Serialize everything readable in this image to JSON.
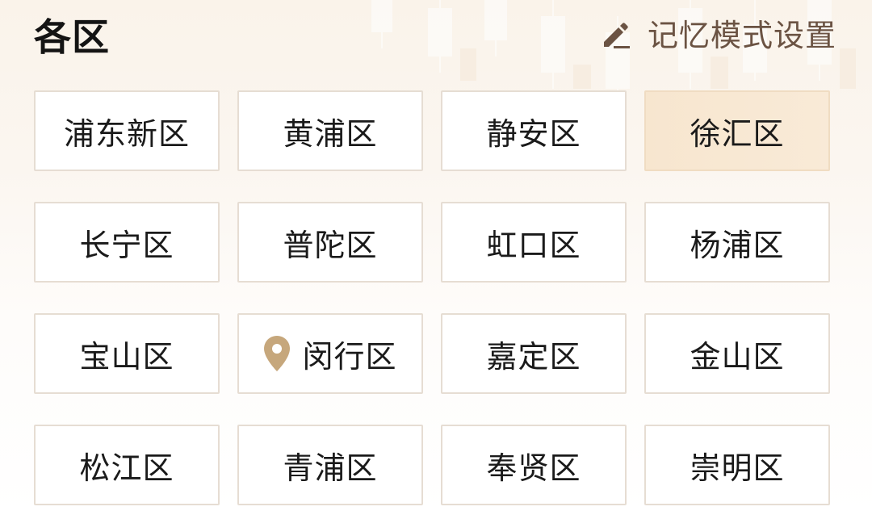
{
  "header": {
    "title": "各区",
    "memory_mode_label": "记忆模式设置"
  },
  "districts": [
    {
      "label": "浦东新区",
      "selected": false,
      "located": false
    },
    {
      "label": "黄浦区",
      "selected": false,
      "located": false
    },
    {
      "label": "静安区",
      "selected": false,
      "located": false
    },
    {
      "label": "徐汇区",
      "selected": true,
      "located": false
    },
    {
      "label": "长宁区",
      "selected": false,
      "located": false
    },
    {
      "label": "普陀区",
      "selected": false,
      "located": false
    },
    {
      "label": "虹口区",
      "selected": false,
      "located": false
    },
    {
      "label": "杨浦区",
      "selected": false,
      "located": false
    },
    {
      "label": "宝山区",
      "selected": false,
      "located": false
    },
    {
      "label": "闵行区",
      "selected": false,
      "located": true
    },
    {
      "label": "嘉定区",
      "selected": false,
      "located": false
    },
    {
      "label": "金山区",
      "selected": false,
      "located": false
    },
    {
      "label": "松江区",
      "selected": false,
      "located": false
    },
    {
      "label": "青浦区",
      "selected": false,
      "located": false
    },
    {
      "label": "奉贤区",
      "selected": false,
      "located": false
    },
    {
      "label": "崇明区",
      "selected": false,
      "located": false
    }
  ],
  "icons": {
    "edit": "pencil-icon",
    "location": "location-pin-icon"
  },
  "colors": {
    "selected_bg": "#f7e6cf",
    "border": "#e6ddd3",
    "accent_brown": "#6b5343",
    "pin": "#c6a77c"
  }
}
